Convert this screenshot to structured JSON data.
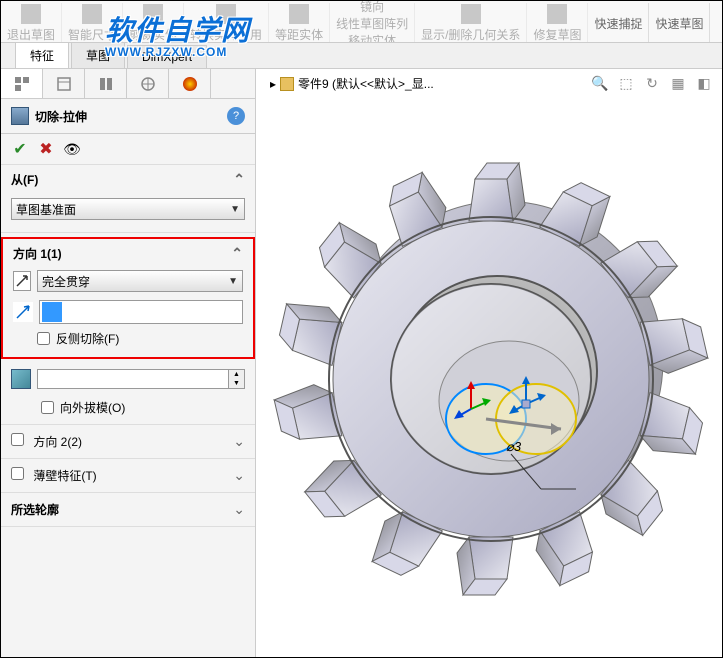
{
  "ribbon": {
    "items": [
      "退出草图",
      "智能尺寸",
      "剪裁实体",
      "转换实体引用",
      "等距实体",
      "镜向",
      "线性草图阵列",
      "显示/删除几何关系",
      "修复草图",
      "快速捕捉",
      "快速草图"
    ],
    "sub_label": "移动实体"
  },
  "tabs": {
    "feature": "特征",
    "sketch": "草图",
    "dimxpert": "DimXpert"
  },
  "watermark": {
    "cn": "软件自学网",
    "en": "WWW.RJZXW.COM"
  },
  "panel": {
    "title": "切除-拉伸",
    "help": "?",
    "from": {
      "label": "从(F)",
      "value": "草图基准面"
    },
    "dir1": {
      "label": "方向 1(1)",
      "end_condition": "完全贯穿",
      "flip_side": "反侧切除(F)"
    },
    "draft": {
      "outward": "向外拔模(O)"
    },
    "dir2": "方向 2(2)",
    "thin": "薄壁特征(T)",
    "contours": "所选轮廓"
  },
  "viewport": {
    "breadcrumb": "零件9  (默认<<默认>_显...",
    "dimension": "⌀3"
  }
}
